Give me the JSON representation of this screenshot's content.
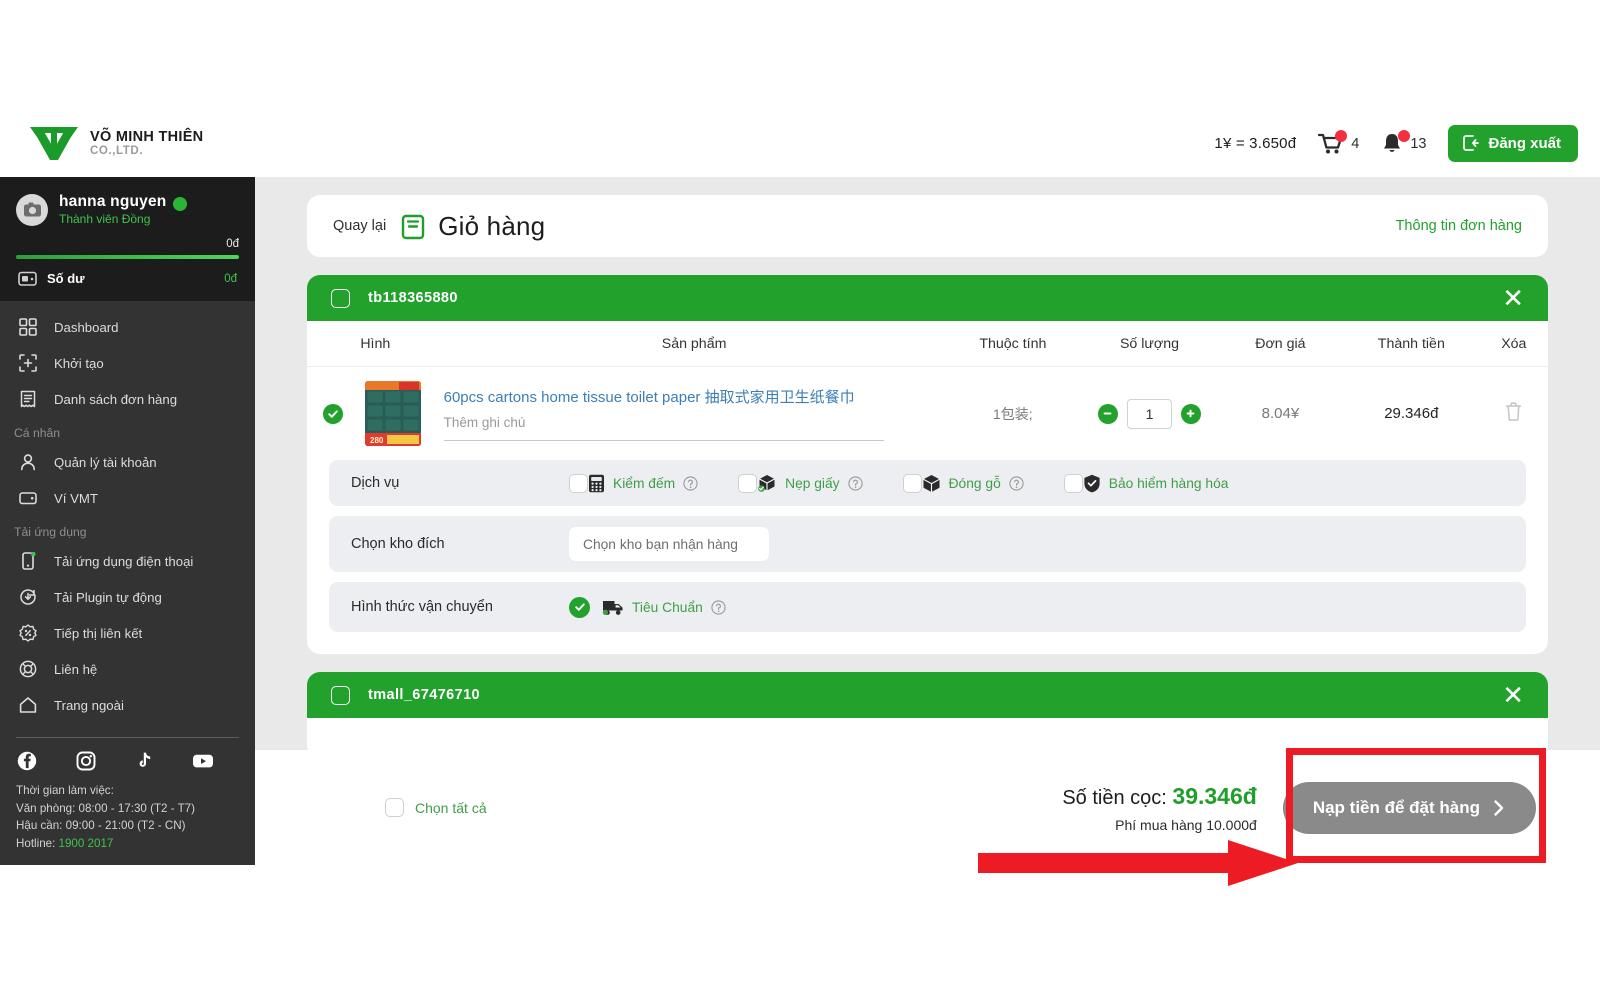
{
  "header": {
    "logo_name": "VÕ MINH THIÊN",
    "logo_sub": "CO.,LTD.",
    "exchange_rate": "1¥ = 3.650đ",
    "cart_count": "4",
    "bell_count": "13",
    "logout_label": "Đăng xuất"
  },
  "sidebar": {
    "user_name": "hanna nguyen",
    "user_role": "Thành viên Đồng",
    "balance_top": "0đ",
    "balance_label": "Số dư",
    "balance_value": "0đ",
    "items": [
      {
        "label": "Dashboard",
        "icon": "grid-icon"
      },
      {
        "label": "Khởi tạo",
        "icon": "plus-frame-icon"
      },
      {
        "label": "Danh sách đơn hàng",
        "icon": "order-list-icon"
      }
    ],
    "group_personal": "Cá nhân",
    "personal_items": [
      {
        "label": "Quản lý tài khoản",
        "icon": "user-icon"
      },
      {
        "label": "Ví VMT",
        "icon": "wallet-icon"
      }
    ],
    "group_apps": "Tải ứng dụng",
    "app_items": [
      {
        "label": "Tải ứng dụng điện thoại",
        "icon": "mobile-icon"
      },
      {
        "label": "Tải Plugin tự động",
        "icon": "download-icon"
      },
      {
        "label": "Tiếp thị liên kết",
        "icon": "percent-badge-icon"
      },
      {
        "label": "Liên hệ",
        "icon": "lifebuoy-icon"
      },
      {
        "label": "Trang ngoài",
        "icon": "home-icon"
      }
    ],
    "socials": [
      "facebook-icon",
      "instagram-icon",
      "tiktok-icon",
      "youtube-icon"
    ],
    "hours_title": "Thời gian làm việc:",
    "hours_office": "Văn phòng: 08:00 - 17:30 (T2 - T7)",
    "hours_logistics": "Hậu cần: 09:00 - 21:00 (T2 - CN)",
    "hotline_label": "Hotline: ",
    "hotline_number": "1900 2017"
  },
  "page": {
    "back_label": "Quay lại",
    "title": "Giỏ hàng",
    "order_info_link": "Thông tin đơn hàng"
  },
  "shops": [
    {
      "id": "tb118365880",
      "columns": [
        "Hình",
        "Sản phẩm",
        "Thuộc tính",
        "Số lượng",
        "Đơn giá",
        "Thành tiền",
        "Xóa"
      ],
      "product": {
        "name": "60pcs cartons home tissue toilet paper 抽取式家用卫生纸餐巾",
        "note_placeholder": "Thêm ghi chú",
        "attribute": "1包装;",
        "quantity": "1",
        "unit_price": "8.04¥",
        "line_total": "29.346đ"
      },
      "services_label": "Dịch vụ",
      "services": [
        {
          "label": "Kiểm đếm",
          "icon": "calculator-icon",
          "checked": false
        },
        {
          "label": "Nẹp giấy",
          "icon": "box-strap-icon",
          "checked": false
        },
        {
          "label": "Đóng gỗ",
          "icon": "wood-box-icon",
          "checked": false
        },
        {
          "label": "Bảo hiểm hàng hóa",
          "icon": "shield-check-icon",
          "checked": false
        }
      ],
      "warehouse_label": "Chọn kho đích",
      "warehouse_placeholder": "Chọn kho bạn nhận hàng",
      "shipping_label": "Hình thức vận chuyển",
      "shipping_option": "Tiêu Chuẩn"
    },
    {
      "id": "tmall_67476710"
    }
  ],
  "bottom": {
    "select_all_label": "Chọn tất cả",
    "deposit_label": "Số tiền cọc: ",
    "deposit_value": "39.346đ",
    "fee_label": "Phí mua hàng 10.000đ",
    "pay_button": "Nạp tiền để đặt hàng"
  },
  "colors": {
    "brand_green": "#22a12d",
    "sidebar_bg": "#333333",
    "annotation_red": "#ed1c24",
    "disabled_gray": "#8a8a8a",
    "link_blue": "#3d7fb5"
  }
}
